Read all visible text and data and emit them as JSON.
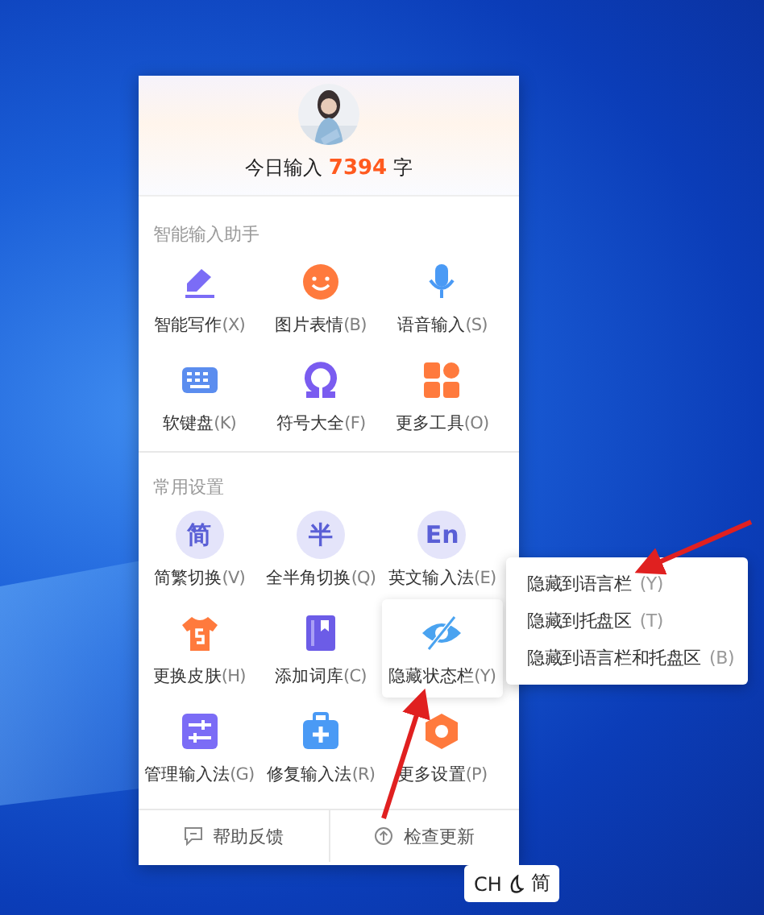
{
  "header": {
    "count_prefix": "今日输入",
    "count": "7394",
    "count_suffix": "字"
  },
  "sections": [
    {
      "title": "智能输入助手",
      "items": [
        {
          "label": "智能写作",
          "shortcut": "(X)",
          "kind": "pen",
          "highlighted": false
        },
        {
          "label": "图片表情",
          "shortcut": "(B)",
          "kind": "smile",
          "highlighted": false
        },
        {
          "label": "语音输入",
          "shortcut": "(S)",
          "kind": "mic",
          "highlighted": false
        },
        {
          "label": "软键盘",
          "shortcut": "(K)",
          "kind": "keyboard",
          "highlighted": false
        },
        {
          "label": "符号大全",
          "shortcut": "(F)",
          "kind": "omega",
          "highlighted": false
        },
        {
          "label": "更多工具",
          "shortcut": "(O)",
          "kind": "tiles",
          "highlighted": false
        }
      ]
    },
    {
      "title": "常用设置",
      "items": [
        {
          "label": "简繁切换",
          "shortcut": "(V)",
          "kind": "glyph",
          "glyph": "简",
          "highlighted": false
        },
        {
          "label": "全半角切换",
          "shortcut": "(Q)",
          "kind": "glyph",
          "glyph": "半",
          "highlighted": false
        },
        {
          "label": "英文输入法",
          "shortcut": "(E)",
          "kind": "glyph",
          "glyph": "En",
          "highlighted": false
        },
        {
          "label": "更换皮肤",
          "shortcut": "(H)",
          "kind": "shirt",
          "highlighted": false
        },
        {
          "label": "添加词库",
          "shortcut": "(C)",
          "kind": "book",
          "highlighted": false
        },
        {
          "label": "隐藏状态栏",
          "shortcut": "(Y)",
          "kind": "eye-off",
          "highlighted": true
        },
        {
          "label": "管理输入法",
          "shortcut": "(G)",
          "kind": "sliders",
          "highlighted": false
        },
        {
          "label": "修复输入法",
          "shortcut": "(R)",
          "kind": "toolbox",
          "highlighted": false
        },
        {
          "label": "更多设置",
          "shortcut": "(P)",
          "kind": "hexagon",
          "highlighted": false
        }
      ]
    }
  ],
  "footer": [
    {
      "label": "帮助反馈",
      "kind": "chat"
    },
    {
      "label": "检查更新",
      "kind": "upload"
    }
  ],
  "submenu": [
    {
      "label": "隐藏到语言栏",
      "shortcut": "(Y)"
    },
    {
      "label": "隐藏到托盘区",
      "shortcut": "(T)"
    },
    {
      "label": "隐藏到语言栏和托盘区",
      "shortcut": "(B)"
    }
  ],
  "taskbar_chip": {
    "language": "CH",
    "mode": "简"
  }
}
